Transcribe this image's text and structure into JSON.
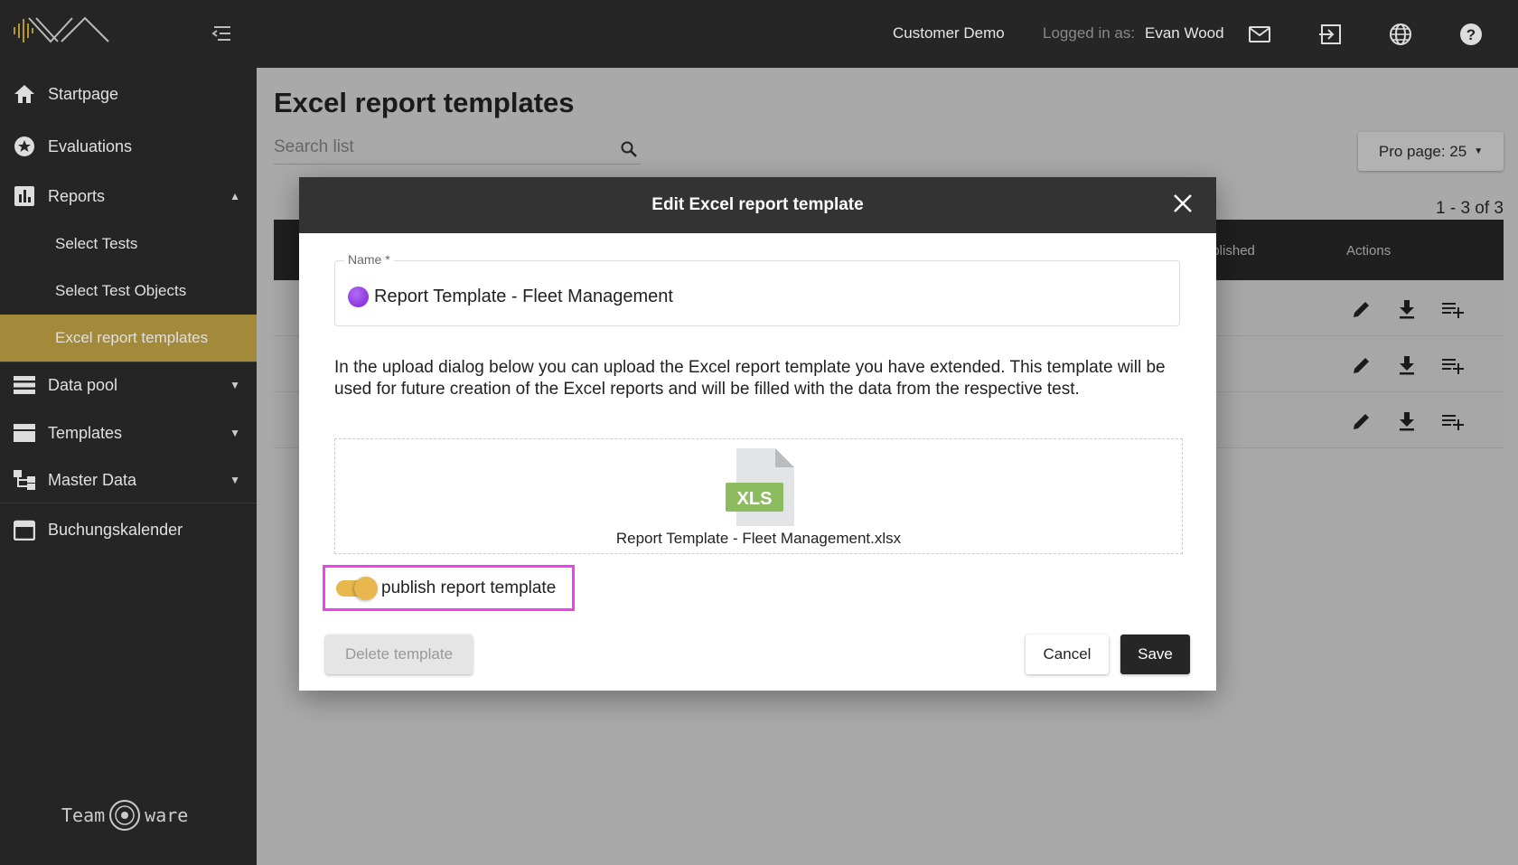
{
  "sidebar": {
    "items": [
      {
        "label": "Startpage",
        "icon": "home-icon"
      },
      {
        "label": "Evaluations",
        "icon": "star-icon"
      },
      {
        "label": "Reports",
        "icon": "bar-chart-icon"
      },
      {
        "label": "Select Tests"
      },
      {
        "label": "Select Test Objects"
      },
      {
        "label": "Excel report templates",
        "active": true
      },
      {
        "label": "Data pool",
        "icon": "list-icon"
      },
      {
        "label": "Templates",
        "icon": "template-icon"
      },
      {
        "label": "Master Data",
        "icon": "hierarchy-icon"
      },
      {
        "label": "Buchungskalender",
        "icon": "calendar-icon"
      }
    ],
    "footer_logo": "Team ware SOLUTIONS",
    "accent": "#a3893a"
  },
  "topbar": {
    "customer": "Customer Demo",
    "logged_in_label": "Logged in as:",
    "user": "Evan Wood"
  },
  "page": {
    "title": "Excel report templates",
    "search_placeholder": "Search list",
    "per_page": "Pro page: 25",
    "count": "1 - 3 of 3",
    "columns": {
      "published": "ublished",
      "actions": "Actions"
    }
  },
  "modal": {
    "title": "Edit Excel report template",
    "name_label": "Name *",
    "name_value": "Report Template -  Fleet Management",
    "description": "In the upload dialog below you can upload the Excel report template you have extended. This template will be used for future creation of the Excel reports and will be filled with the data from the respective test.",
    "file_badge": "XLS",
    "file_name": "Report Template - Fleet Management.xlsx",
    "publish_label": "publish report template",
    "publish_on": true,
    "delete": "Delete template",
    "cancel": "Cancel",
    "save": "Save"
  }
}
